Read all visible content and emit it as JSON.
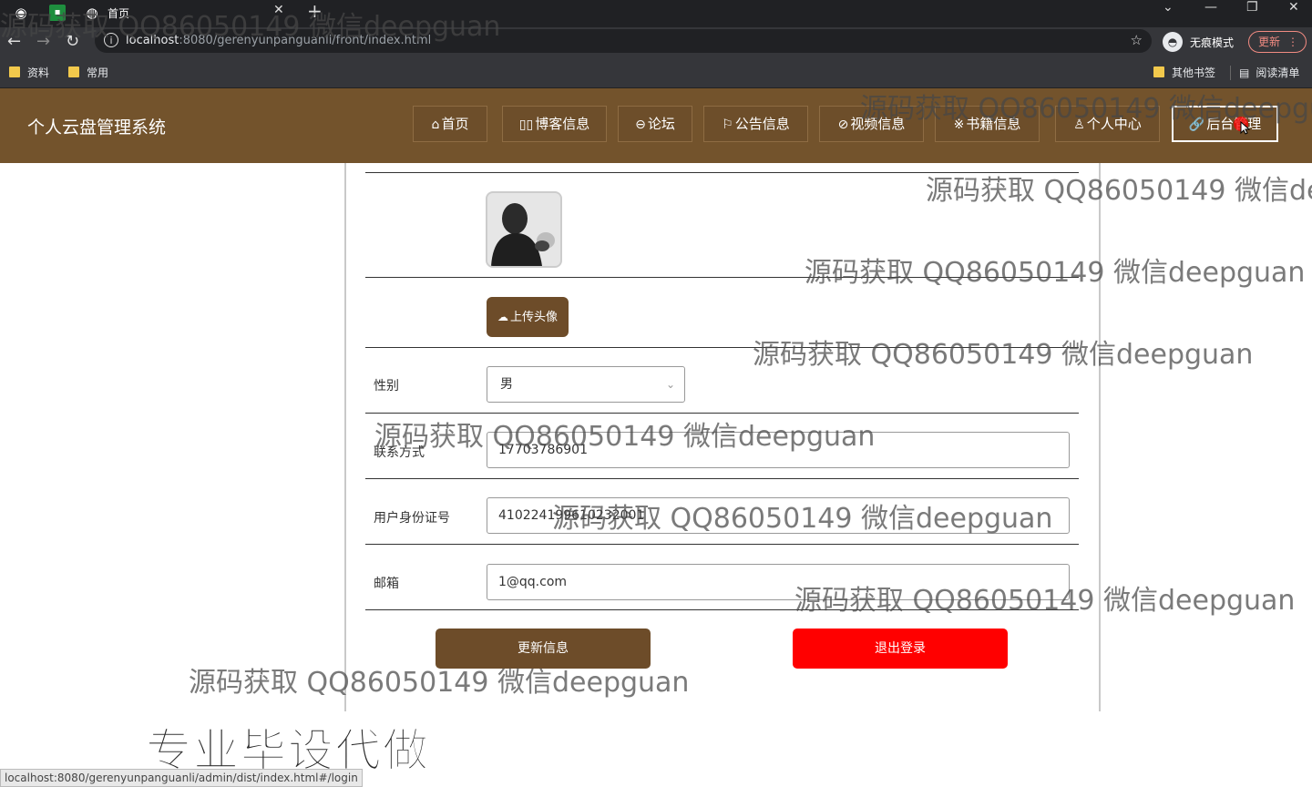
{
  "browser": {
    "tab_title": "首页",
    "url_host": "localhost",
    "url_rest": ":8080/gerenyunpanguanli/front/index.html",
    "incognito_label": "无痕模式",
    "update_label": "更新",
    "bookmarks": [
      "资料",
      "常用"
    ],
    "bookmarks_right": [
      "其他书签",
      "阅读清单"
    ]
  },
  "site": {
    "title": "个人云盘管理系统",
    "nav": [
      {
        "icon": "⌂",
        "label": "首页"
      },
      {
        "icon": "▯▯",
        "label": "博客信息"
      },
      {
        "icon": "⊖",
        "label": "论坛"
      },
      {
        "icon": "⚐",
        "label": "公告信息"
      },
      {
        "icon": "⊘",
        "label": "视频信息"
      },
      {
        "icon": "※",
        "label": "书籍信息"
      },
      {
        "icon": "♙",
        "label": "个人中心"
      },
      {
        "icon": "🔗",
        "label": "后台管理"
      }
    ]
  },
  "profile": {
    "upload_label": "上传头像",
    "gender_label": "性别",
    "gender_value": "男",
    "phone_label": "联系方式",
    "phone_value": "17703786901",
    "idcard_label": "用户身份证号",
    "idcard_value": "410224199610232001",
    "email_label": "邮箱",
    "email_value": "1@qq.com",
    "update_button": "更新信息",
    "logout_button": "退出登录"
  },
  "overlay": {
    "watermark": "源码获取 QQ86050149 微信deepguan",
    "promo_text": "专业毕设代做",
    "status_url": "localhost:8080/gerenyunpanguanli/admin/dist/index.html#/login"
  },
  "colors": {
    "header_bg": "#73532c",
    "primary_button": "#6d4c29",
    "logout_button": "#ff0000"
  }
}
